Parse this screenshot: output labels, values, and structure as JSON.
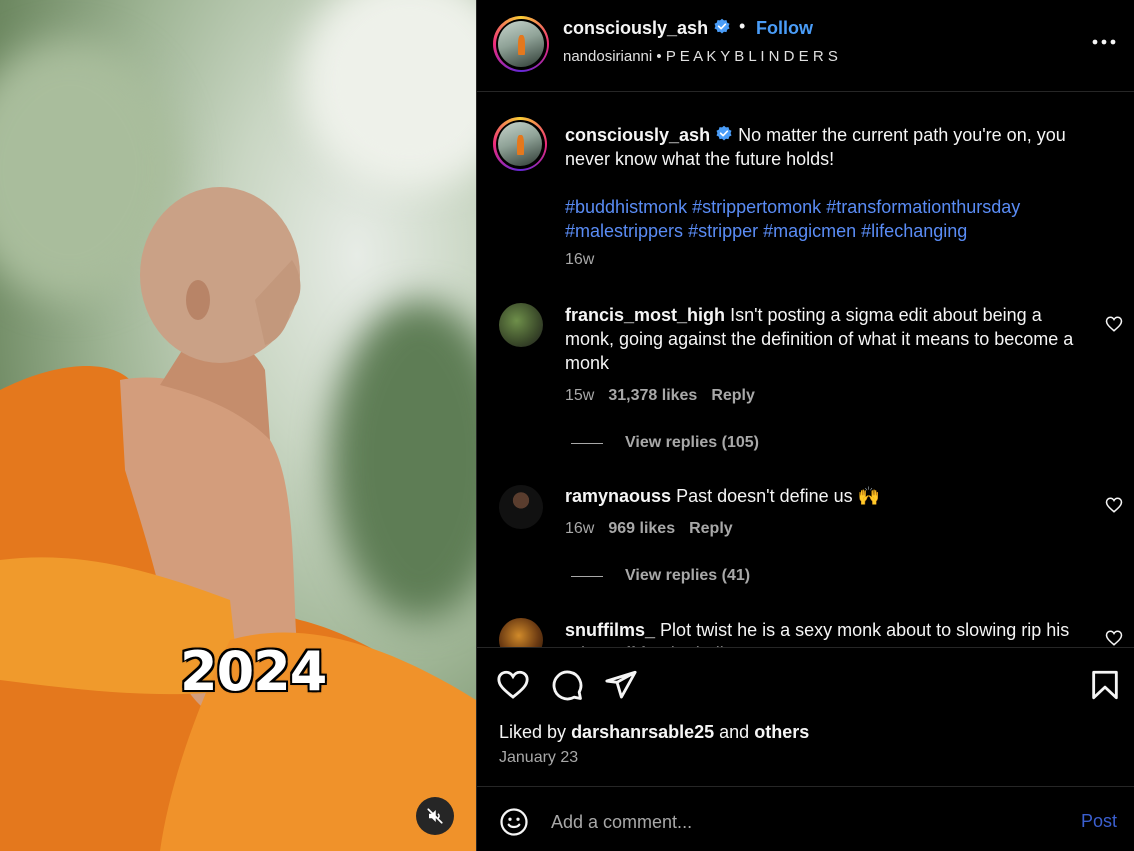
{
  "media": {
    "overlay_caption": "2024",
    "mute_icon": "speaker-muted-icon"
  },
  "header": {
    "username": "consciously_ash",
    "separator": "•",
    "follow_label": "Follow",
    "subtitle": "nandosirianni • P E A K Y B L I N D E R S",
    "more_icon": "more-options-icon"
  },
  "caption": {
    "username": "consciously_ash",
    "text": "No matter the current path you're on, you never know what the future holds!",
    "hashtags": [
      "#buddhistmonk",
      "#strippertomonk",
      "#transformationthursday",
      "#malestrippers",
      "#stripper",
      "#magicmen",
      "#lifechanging"
    ],
    "age": "16w"
  },
  "comments": [
    {
      "username": "francis_most_high",
      "text": "Isn't posting a sigma edit about being a monk, going against the definition of what it means to become a monk",
      "age": "15w",
      "likes": "31,378 likes",
      "reply_label": "Reply",
      "view_replies": "View replies (105)"
    },
    {
      "username": "ramynaouss",
      "text": "Past doesn't define us 🙌",
      "age": "16w",
      "likes": "969 likes",
      "reply_label": "Reply",
      "view_replies": "View replies (41)"
    },
    {
      "username": "snuffilms_",
      "text": "Plot twist he is a sexy monk about to slowing rip his robes off for the ladies"
    }
  ],
  "actions": {
    "liked_by_prefix": "Liked by",
    "liked_by_user": "darshanrsable25",
    "liked_by_and": "and",
    "liked_by_others": "others",
    "date": "January 23"
  },
  "comment_bar": {
    "placeholder": "Add a comment...",
    "post_label": "Post"
  },
  "colors": {
    "link_blue": "#4a9df8",
    "hashtag_blue": "#5a8cf5",
    "monk_robe": "#e4781d",
    "verified_blue": "#4a9df8"
  }
}
